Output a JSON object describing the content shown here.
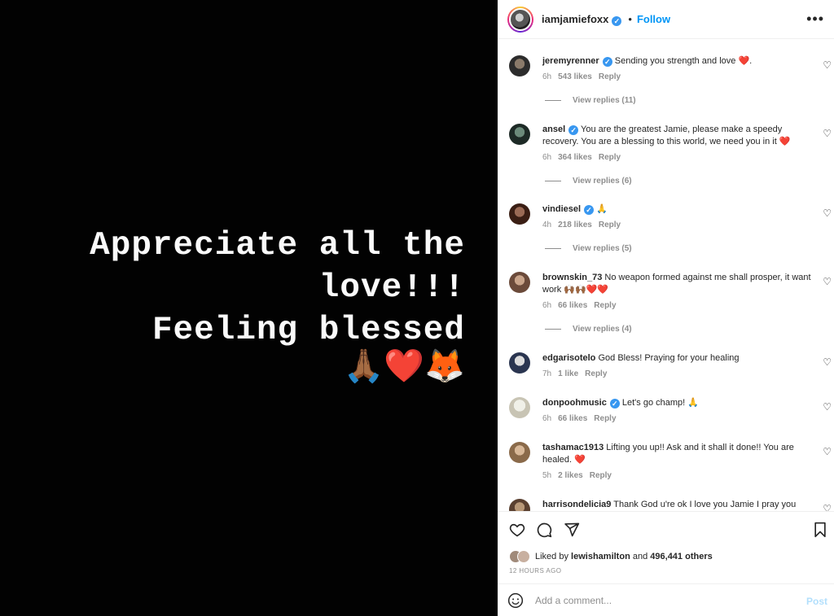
{
  "post": {
    "lines": [
      "Appreciate all the",
      "love!!!",
      "Feeling blessed"
    ],
    "emoji": "🙏🏾❤️🦊"
  },
  "header": {
    "username": "iamjamiefoxx",
    "dot": "•",
    "follow_label": "Follow",
    "more": "•••"
  },
  "comments": [
    {
      "user": "jeremyrenner",
      "verified": true,
      "text": "Sending you strength and love",
      "emoji": "❤️",
      "tail": ".",
      "time": "6h",
      "likes": "543 likes",
      "reply": "Reply",
      "view_replies": "View replies (11)"
    },
    {
      "user": "ansel",
      "verified": true,
      "text": "You are the greatest Jamie, please make a speedy recovery. You are a blessing to this world, we need you in it",
      "emoji": "❤️",
      "tail": "",
      "time": "6h",
      "likes": "364 likes",
      "reply": "Reply",
      "view_replies": "View replies (6)"
    },
    {
      "user": "vindiesel",
      "verified": true,
      "text": "",
      "emoji": "🙏",
      "tail": "",
      "time": "4h",
      "likes": "218 likes",
      "reply": "Reply",
      "view_replies": "View replies (5)"
    },
    {
      "user": "brownskin_73",
      "verified": false,
      "text": "No weapon formed against me shall prosper, it want work",
      "emoji": "🙌🏾🙌🏾❤️❤️",
      "tail": "",
      "time": "6h",
      "likes": "66 likes",
      "reply": "Reply",
      "view_replies": "View replies (4)"
    },
    {
      "user": "edgarisotelo",
      "verified": false,
      "text": "God Bless! Praying for your healing",
      "emoji": "",
      "tail": "",
      "time": "7h",
      "likes": "1 like",
      "reply": "Reply",
      "view_replies": ""
    },
    {
      "user": "donpoohmusic",
      "verified": true,
      "text": "Let's go champ!",
      "emoji": "🙏",
      "tail": "",
      "time": "6h",
      "likes": "66 likes",
      "reply": "Reply",
      "view_replies": ""
    },
    {
      "user": "tashamac1913",
      "verified": false,
      "text": "Lifting you up!! Ask and it shall it done!! You are healed.",
      "emoji": "❤️",
      "tail": "",
      "time": "5h",
      "likes": "2 likes",
      "reply": "Reply",
      "view_replies": ""
    },
    {
      "user": "harrisondelicia9",
      "verified": false,
      "text": "Thank God u're ok I love you Jamie I pray you",
      "emoji": "",
      "tail": "",
      "time": "",
      "likes": "",
      "reply": "",
      "view_replies": ""
    }
  ],
  "icons": [
    "heart-icon",
    "comment-icon",
    "share-icon",
    "bookmark-icon",
    "smile-icon",
    "more-icon",
    "verified-badge"
  ],
  "liked_by": {
    "prefix": "Liked by",
    "user": "lewishamilton",
    "and": "and",
    "count": "496,441 others"
  },
  "timestamp": "12 HOURS AGO",
  "add_comment": {
    "placeholder": "Add a comment...",
    "post_label": "Post"
  },
  "colors": {
    "accent": "#0095f6",
    "verified": "#3897f0",
    "heart": "#ed1c24",
    "post_disabled": "#b2dffc"
  }
}
